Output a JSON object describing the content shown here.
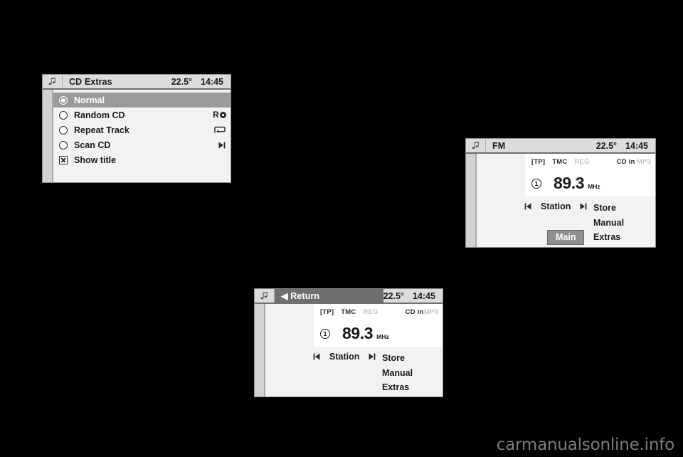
{
  "page": {
    "background_color": "#000000",
    "watermark": "carmanualsonline.info"
  },
  "status": {
    "temperature": "22.5°",
    "time": "14:45"
  },
  "cd_extras_panel": {
    "icon": "music-note-icon",
    "title": "CD Extras",
    "temperature": "22.5°",
    "time": "14:45",
    "items": [
      {
        "label": "Normal",
        "control": "radio",
        "checked": true,
        "selected": true,
        "icon": ""
      },
      {
        "label": "Random CD",
        "control": "radio",
        "checked": false,
        "selected": false,
        "icon": "random-disc-icon"
      },
      {
        "label": "Repeat Track",
        "control": "radio",
        "checked": false,
        "selected": false,
        "icon": "repeat-icon"
      },
      {
        "label": "Scan CD",
        "control": "radio",
        "checked": false,
        "selected": false,
        "icon": "scan-skip-icon"
      },
      {
        "label": "Show title",
        "control": "checkbox",
        "checked": true,
        "selected": false,
        "icon": ""
      }
    ]
  },
  "fm_panel": {
    "icon": "music-note-icon",
    "title": "FM",
    "title_highlighted": false,
    "temperature": "22.5°",
    "time": "14:45",
    "flags": [
      {
        "label": "[TP]",
        "active": true
      },
      {
        "label": "TMC",
        "active": true
      },
      {
        "label": "REG",
        "active": false
      },
      {
        "label": "CD in",
        "active": true
      },
      {
        "label": "MP3",
        "active": false
      }
    ],
    "preset": "1",
    "frequency": "89.3",
    "unit": "MHz",
    "station_label": "Station",
    "prev_icon": "skip-previous-icon",
    "next_icon": "skip-next-icon",
    "menu": [
      "Store",
      "Manual",
      "Extras"
    ],
    "main_button": "Main"
  },
  "return_panel": {
    "icon": "music-note-icon",
    "title": "◀ Return",
    "title_highlighted": true,
    "temperature": "22.5°",
    "time": "14:45",
    "flags": [
      {
        "label": "[TP]",
        "active": true
      },
      {
        "label": "TMC",
        "active": true
      },
      {
        "label": "REG",
        "active": false
      },
      {
        "label": "CD in",
        "active": true
      },
      {
        "label": "MP3",
        "active": false
      }
    ],
    "preset": "1",
    "frequency": "89.3",
    "unit": "MHz",
    "station_label": "Station",
    "prev_icon": "skip-previous-icon",
    "next_icon": "skip-next-icon",
    "menu": [
      "Store",
      "Manual",
      "Extras"
    ]
  },
  "colors": {
    "panel_bg": "#f2f2f2",
    "header_bg": "#dcdcdc",
    "highlight": "#9a9a9a",
    "header_highlight": "#6f6f6f",
    "rail": "#d2d2d2",
    "text": "#1a1a1a",
    "muted": "#c2c2c2",
    "button": "#8f8f8f"
  }
}
